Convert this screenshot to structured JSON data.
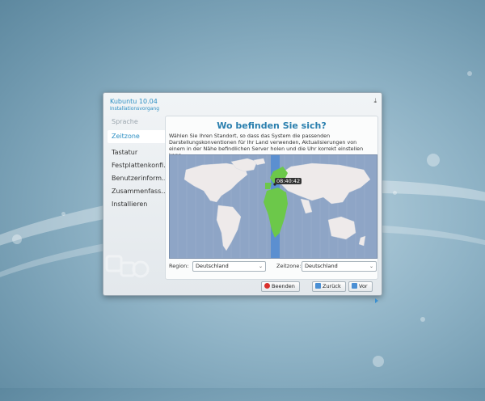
{
  "window": {
    "title": "Kubuntu 10.04",
    "subtitle": "Installationsvorgang",
    "download_icon": "download-icon"
  },
  "sidebar": {
    "items": [
      {
        "label": "Sprache",
        "state": "done"
      },
      {
        "label": "Zeitzone",
        "state": "active"
      },
      {
        "label": "Tastatur",
        "state": "pending"
      },
      {
        "label": "Festplattenkonfi…",
        "state": "pending"
      },
      {
        "label": "Benutzerinform…",
        "state": "pending"
      },
      {
        "label": "Zusammenfass…",
        "state": "pending"
      },
      {
        "label": "Installieren",
        "state": "pending"
      }
    ]
  },
  "main": {
    "heading": "Wo befinden Sie sich?",
    "description": "Wählen Sie Ihren Standort, so dass das System die passenden Darstellungskonventionen für Ihr Land verwenden, Aktualisierungen von einem in der Nähe befindlichen Server holen und die Uhr korrekt einstellen kann.",
    "map_time": "08:40:42",
    "region_label": "Region:",
    "region_value": "Deutschland",
    "timezone_label": "Zeitzone:",
    "timezone_value": "Deutschland"
  },
  "buttons": {
    "quit": "Beenden",
    "back": "Zurück",
    "forward": "Vor"
  },
  "colors": {
    "accent": "#2d8fc3",
    "selected_zone": "#5b8fd0",
    "country_highlight": "#6cc84a",
    "map_ocean": "#8ea5c6",
    "land": "#eeeaea"
  }
}
